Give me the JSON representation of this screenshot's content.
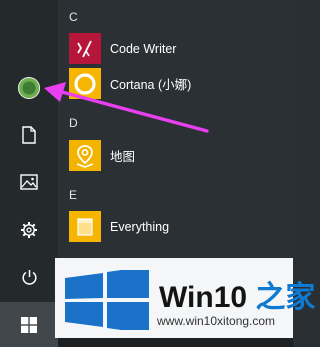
{
  "start_menu": {
    "sections": [
      {
        "letter": "C"
      },
      {
        "letter": "D"
      },
      {
        "letter": "E"
      }
    ],
    "apps": [
      {
        "label": "Code Writer",
        "icon": "code-writer-icon",
        "tile_color": "#b5163a"
      },
      {
        "label": "Cortana (小娜)",
        "icon": "cortana-ring-icon",
        "tile_color": "#f5b500"
      },
      {
        "label": "地图",
        "icon": "map-pin-icon",
        "tile_color": "#f2b400"
      },
      {
        "label": "Everything",
        "icon": "everything-icon",
        "tile_color": "#f5b500"
      }
    ],
    "rail": [
      "avatar",
      "document-icon",
      "pictures-icon",
      "gear-icon",
      "power-icon"
    ]
  },
  "annotation": {
    "arrow_color": "#e83ff0"
  },
  "watermark": {
    "title_prefix": "Win10",
    "title_cn": "之家",
    "url": "www.win10xitong.com"
  }
}
